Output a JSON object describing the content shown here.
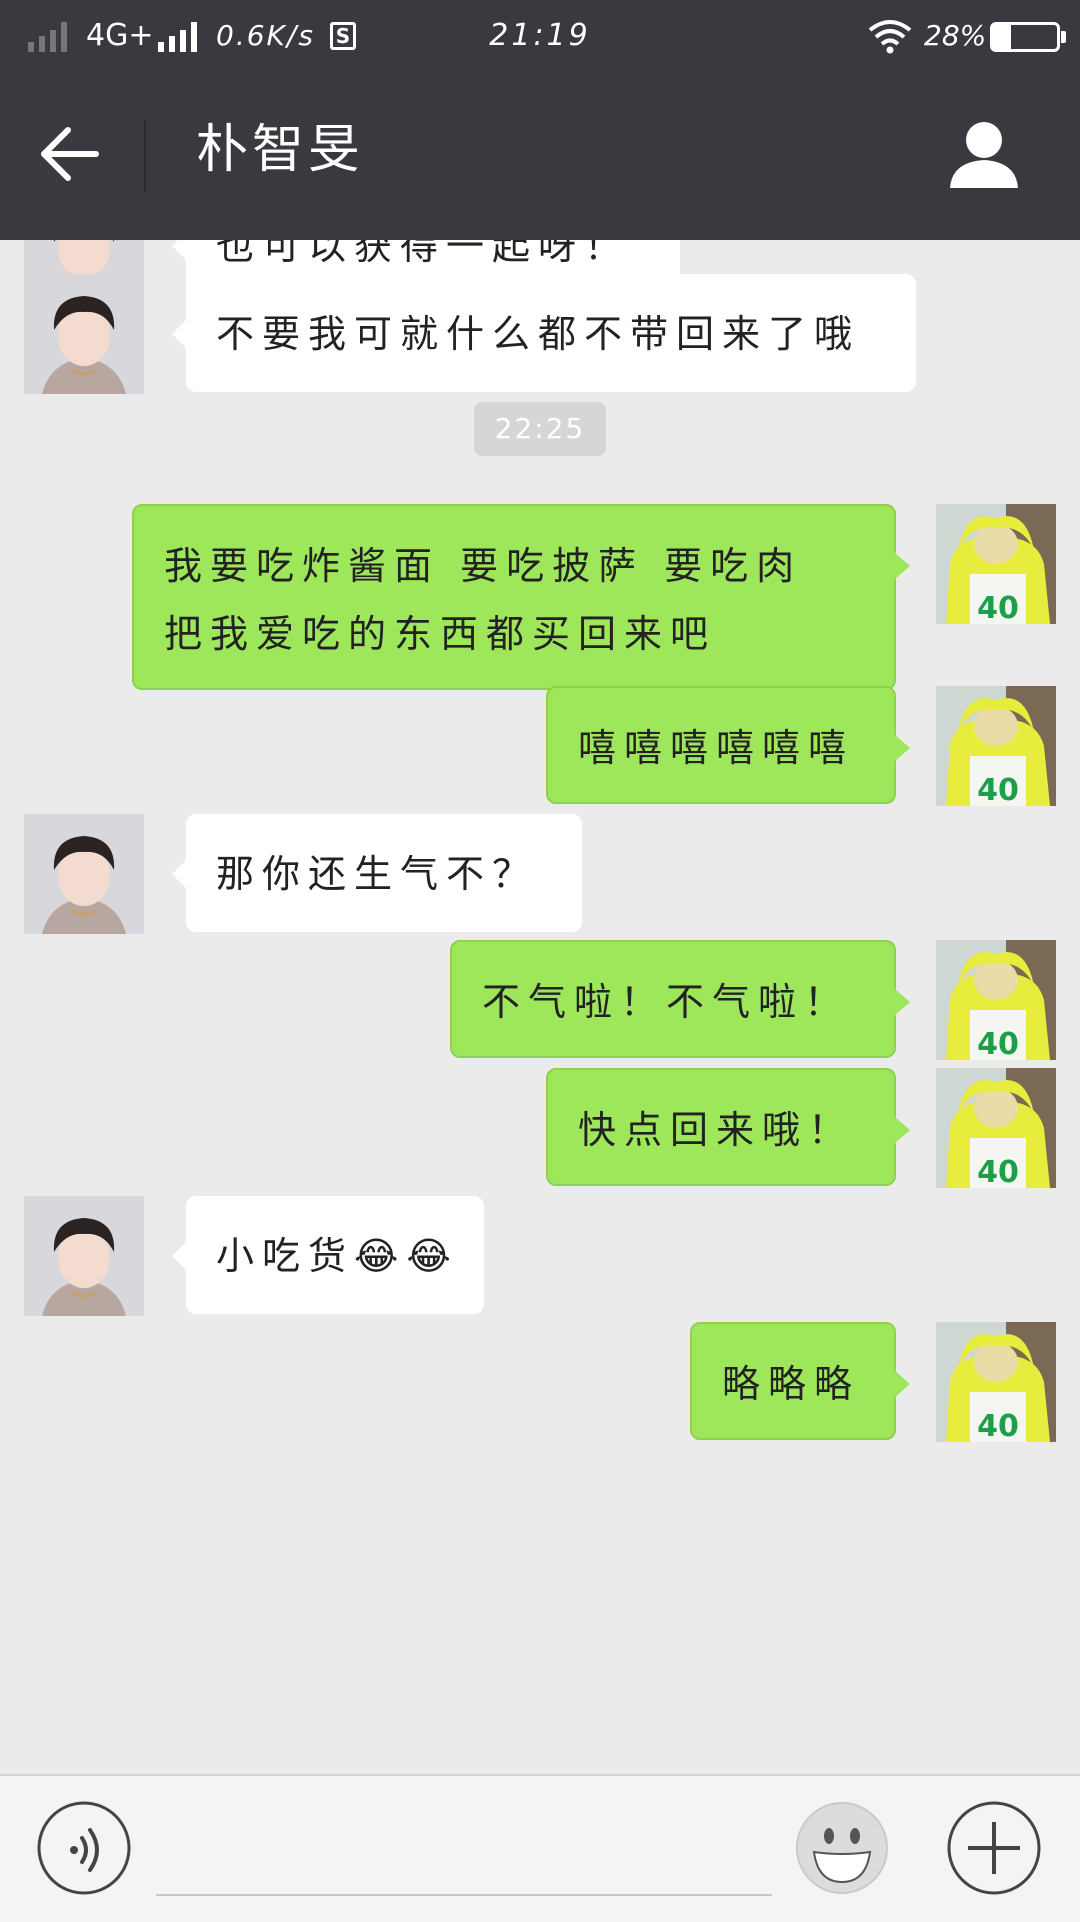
{
  "status_bar": {
    "network": "4G+",
    "speed": "0.6K/s",
    "time": "21:19",
    "battery": "28%",
    "battery_level": 0.28
  },
  "header": {
    "title": "朴智旻"
  },
  "timestamp": "22:25",
  "messages": [
    {
      "side": "in",
      "lines": [
        "也可以获得一起呀！"
      ]
    },
    {
      "side": "in",
      "lines": [
        "不要我可就什么都不带回来了哦"
      ]
    },
    {
      "side": "out",
      "lines": [
        "我要吃炸酱面 要吃披萨 要吃肉",
        "把我爱吃的东西都买回来吧"
      ]
    },
    {
      "side": "out",
      "lines": [
        "嘻嘻嘻嘻嘻嘻"
      ]
    },
    {
      "side": "in",
      "lines": [
        "那你还生气不？"
      ]
    },
    {
      "side": "out",
      "lines": [
        "不气啦！不气啦！"
      ]
    },
    {
      "side": "out",
      "lines": [
        "快点回来哦！"
      ]
    },
    {
      "side": "in",
      "lines": [
        "小吃货😂😂"
      ]
    },
    {
      "side": "out",
      "lines": [
        "略略略"
      ]
    }
  ],
  "avatar_out": {
    "number": "40"
  },
  "colors": {
    "header_bg": "#393a3f",
    "chat_bg": "#ebebeb",
    "bubble_out": "#9fe75a",
    "bubble_in": "#ffffff"
  },
  "icons": {
    "back": "arrow-left-icon",
    "profile": "person-icon",
    "voice": "voice-icon",
    "emoji": "emoji-icon",
    "plus": "plus-icon"
  }
}
